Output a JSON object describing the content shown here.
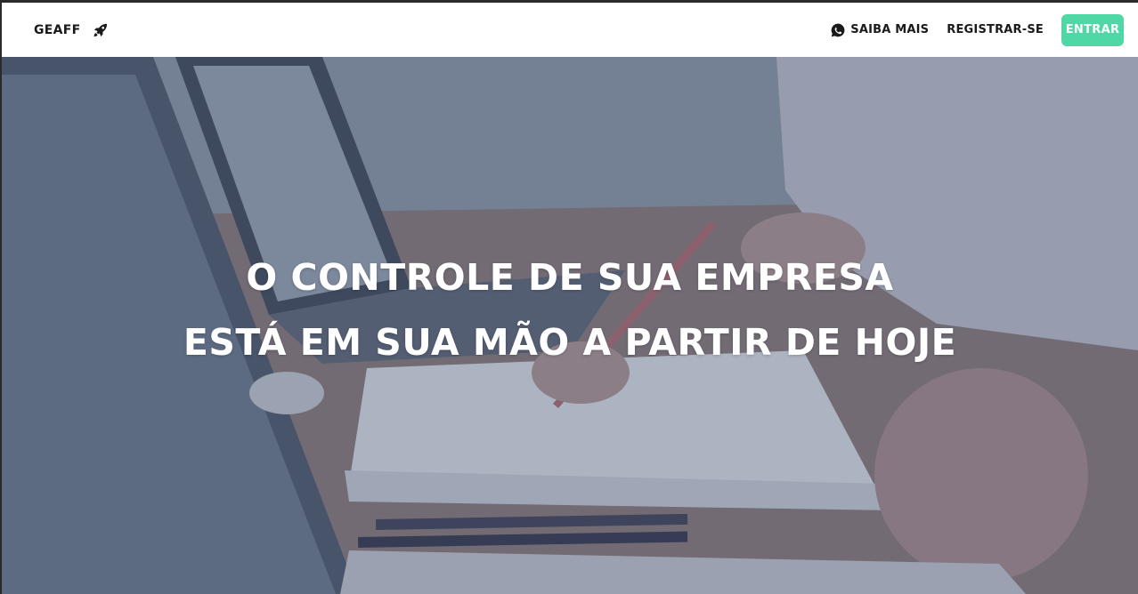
{
  "navbar": {
    "brand_label": "GEAFF",
    "brand_icon": "rocket-icon",
    "links": {
      "saiba_mais": "SAIBA MAIS",
      "saiba_mais_icon": "whatsapp-icon",
      "registrar": "REGISTRAR-SE"
    },
    "login_label": "ENTRAR"
  },
  "hero": {
    "line1": "O CONTROLE DE SUA EMPRESA",
    "line2": "ESTÁ EM SUA MÃO A PARTIR DE HOJE"
  },
  "colors": {
    "accent": "#4fd8a5",
    "navbar_bg": "#ffffff",
    "hero_text": "#ffffff"
  }
}
